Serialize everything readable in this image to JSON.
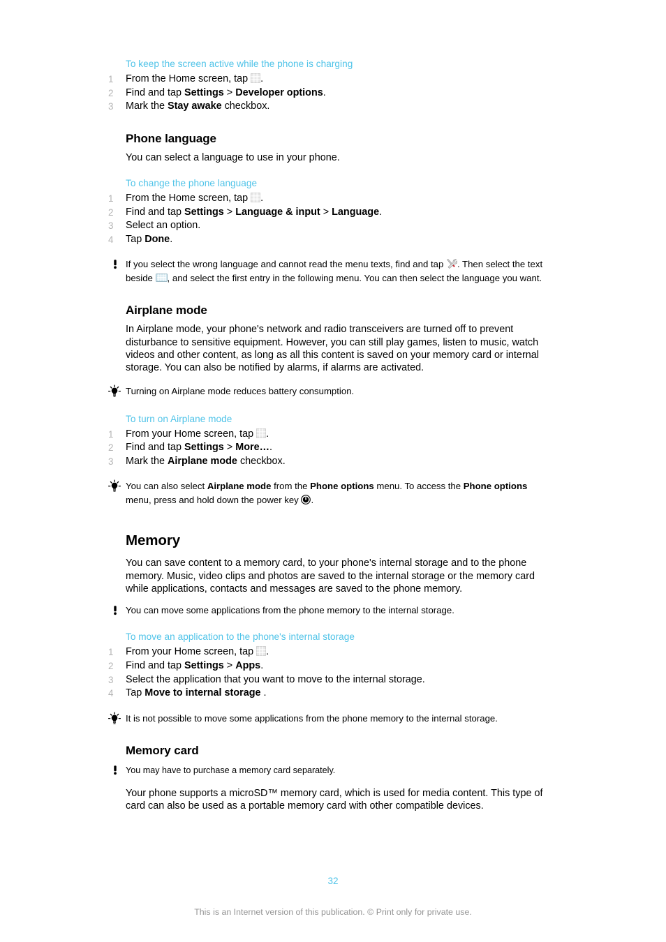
{
  "document": {
    "page_number": "32",
    "footer_note": "This is an Internet version of this publication. © Print only for private use.",
    "accent_color": "#4FC3E8",
    "list_number_color": "#B3B3B3"
  },
  "sections": {
    "keep_screen_active": {
      "heading": "To keep the screen active while the phone is charging",
      "steps": [
        {
          "num": "1",
          "pre": "From the Home screen, tap ",
          "icon": "apps-grid-icon",
          "post": "."
        },
        {
          "num": "2",
          "pre": "Find and tap ",
          "bold1": "Settings",
          "sep": " > ",
          "bold2": "Developer options",
          "post": "."
        },
        {
          "num": "3",
          "pre": "Mark the ",
          "bold1": "Stay awake",
          "post": " checkbox."
        }
      ]
    },
    "phone_language": {
      "heading": "Phone language",
      "intro": "You can select a language to use in your phone.",
      "sub_heading": "To change the phone language",
      "steps": [
        {
          "num": "1",
          "pre": "From the Home screen, tap ",
          "icon": "apps-grid-icon",
          "post": "."
        },
        {
          "num": "2",
          "pre": "Find and tap ",
          "bold1": "Settings",
          "sep": " > ",
          "bold2": "Language & input",
          "sep2": " > ",
          "bold3": "Language",
          "post": "."
        },
        {
          "num": "3",
          "pre": "Select an option."
        },
        {
          "num": "4",
          "pre": "Tap ",
          "bold1": "Done",
          "post": "."
        }
      ],
      "note": {
        "icon": "exclamation-note-icon",
        "part1": "If you select the wrong language and cannot read the menu texts, find and tap ",
        "icon1": "tools-icon",
        "part2": ". Then select the text beside ",
        "icon2": "keyboard-icon",
        "part3": ", and select the first entry in the following menu. You can then select the language you want."
      }
    },
    "airplane_mode": {
      "heading": "Airplane mode",
      "body": "In Airplane mode, your phone's network and radio transceivers are turned off to prevent disturbance to sensitive equipment. However, you can still play games, listen to music, watch videos and other content, as long as all this content is saved on your memory card or internal storage. You can also be notified by alarms, if alarms are activated.",
      "tip1": {
        "icon": "lightbulb-tip-icon",
        "text": "Turning on Airplane mode reduces battery consumption."
      },
      "sub_heading": "To turn on Airplane mode",
      "steps": [
        {
          "num": "1",
          "pre": "From your Home screen, tap ",
          "icon": "apps-grid-icon",
          "post": "."
        },
        {
          "num": "2",
          "pre": "Find and tap ",
          "bold1": "Settings",
          "sep": " > ",
          "bold2": "More…",
          "post": "."
        },
        {
          "num": "3",
          "pre": "Mark the ",
          "bold1": "Airplane mode",
          "post": " checkbox."
        }
      ],
      "tip2": {
        "icon": "lightbulb-tip-icon",
        "part1": "You can also select ",
        "bold1": "Airplane mode",
        "part2": " from the ",
        "bold2": "Phone options",
        "part3": " menu. To access the ",
        "bold3": "Phone options",
        "part4": " menu, press and hold down the power key ",
        "icon1": "power-key-icon",
        "part5": "."
      }
    },
    "memory": {
      "heading": "Memory",
      "body": "You can save content to a memory card, to your phone's internal storage and to the phone memory. Music, video clips and photos are saved to the internal storage or the memory card while applications, contacts and messages are saved to the phone memory.",
      "note": {
        "icon": "exclamation-note-icon",
        "text": "You can move some applications from the phone memory to the internal storage."
      },
      "sub_heading": "To move an application to the phone's internal storage",
      "steps": [
        {
          "num": "1",
          "pre": "From your Home screen, tap ",
          "icon": "apps-grid-icon",
          "post": "."
        },
        {
          "num": "2",
          "pre": "Find and tap ",
          "bold1": "Settings",
          "sep": " > ",
          "bold2": "Apps",
          "post": "."
        },
        {
          "num": "3",
          "pre": "Select the application that you want to move to the internal storage."
        },
        {
          "num": "4",
          "pre": "Tap ",
          "bold1": "Move to internal storage",
          "post": " ."
        }
      ],
      "tip": {
        "icon": "lightbulb-tip-icon",
        "text": "It is not possible to move some applications from the phone memory to the internal storage."
      }
    },
    "memory_card": {
      "heading": "Memory card",
      "note": {
        "icon": "exclamation-note-icon",
        "text": "You may have to purchase a memory card separately."
      },
      "body": "Your phone supports a microSD™ memory card, which is used for media content. This type of card can also be used as a portable memory card with other compatible devices."
    }
  }
}
